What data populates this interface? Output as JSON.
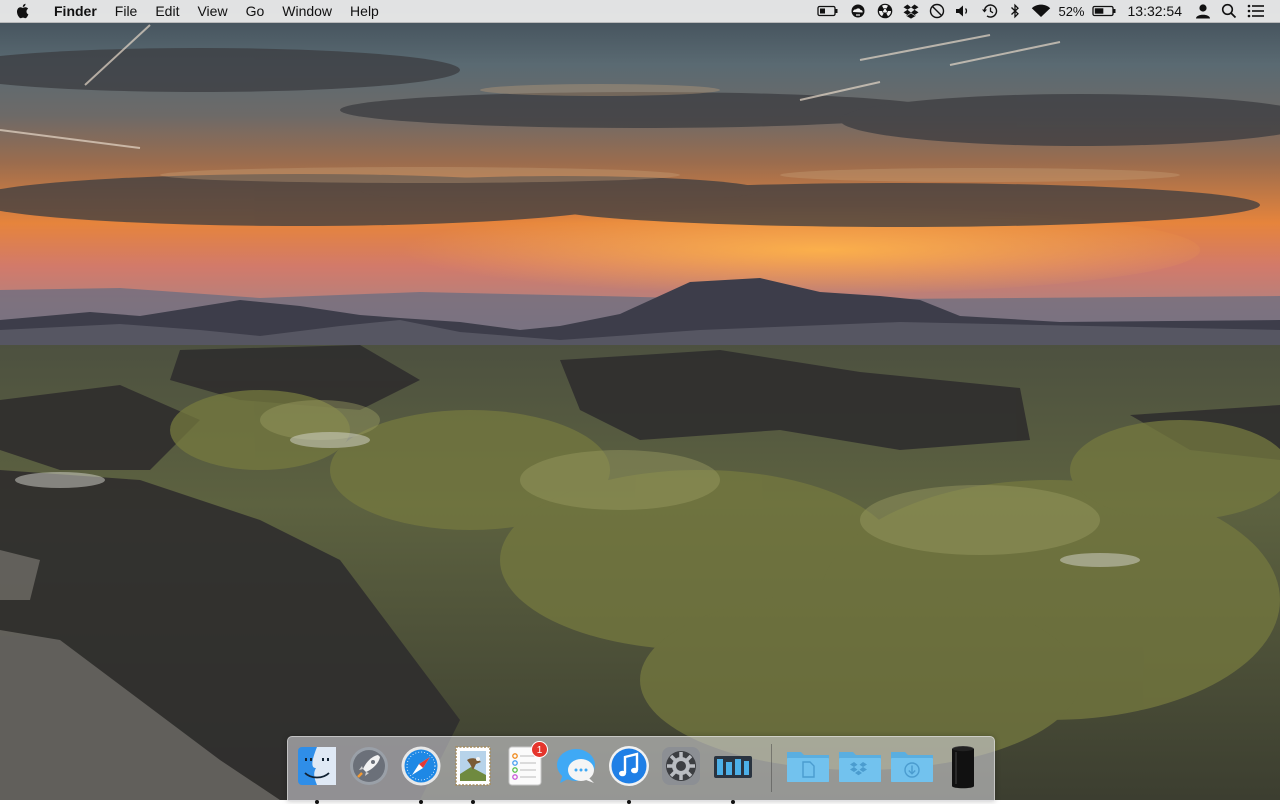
{
  "menubar": {
    "apple_icon": "apple-logo-icon",
    "app_name": "Finder",
    "menus": [
      "File",
      "Edit",
      "View",
      "Go",
      "Window",
      "Help"
    ],
    "status_icons": [
      "battery-meter-icon",
      "cloud-sync-icon",
      "radiation-icon",
      "dropbox-icon",
      "do-not-disturb-icon",
      "volume-icon",
      "time-machine-icon",
      "bluetooth-icon",
      "wifi-icon"
    ],
    "battery_percent": "52%",
    "battery_level": 0.52,
    "clock": "13:32:54",
    "user_icon": "user-icon",
    "spotlight_icon": "spotlight-search-icon",
    "notification_icon": "notification-center-icon"
  },
  "dock": {
    "apps": [
      {
        "name": "Finder",
        "icon": "finder-icon",
        "running": true
      },
      {
        "name": "Launchpad",
        "icon": "launchpad-rocket-icon",
        "running": false
      },
      {
        "name": "Safari",
        "icon": "safari-compass-icon",
        "running": true
      },
      {
        "name": "Mail",
        "icon": "mail-stamp-icon",
        "running": true
      },
      {
        "name": "Reminders",
        "icon": "reminders-icon",
        "running": false,
        "badge": "1"
      },
      {
        "name": "Messages",
        "icon": "messages-bubble-icon",
        "running": false
      },
      {
        "name": "iTunes",
        "icon": "itunes-note-icon",
        "running": true
      },
      {
        "name": "System Preferences",
        "icon": "gear-icon",
        "running": false
      },
      {
        "name": "iStat Menus",
        "icon": "meters-icon",
        "running": true
      }
    ],
    "folders": [
      {
        "name": "Documents",
        "icon": "documents-folder-icon"
      },
      {
        "name": "Dropbox",
        "icon": "dropbox-folder-icon"
      },
      {
        "name": "Downloads",
        "icon": "downloads-folder-icon"
      },
      {
        "name": "Trash",
        "icon": "trash-can-icon"
      }
    ]
  },
  "colors": {
    "menubar_bg": "#eeeeee",
    "badge_red": "#e5352c",
    "folder_blue": "#6fc3ee",
    "sky_glow": "#f08a3a"
  }
}
